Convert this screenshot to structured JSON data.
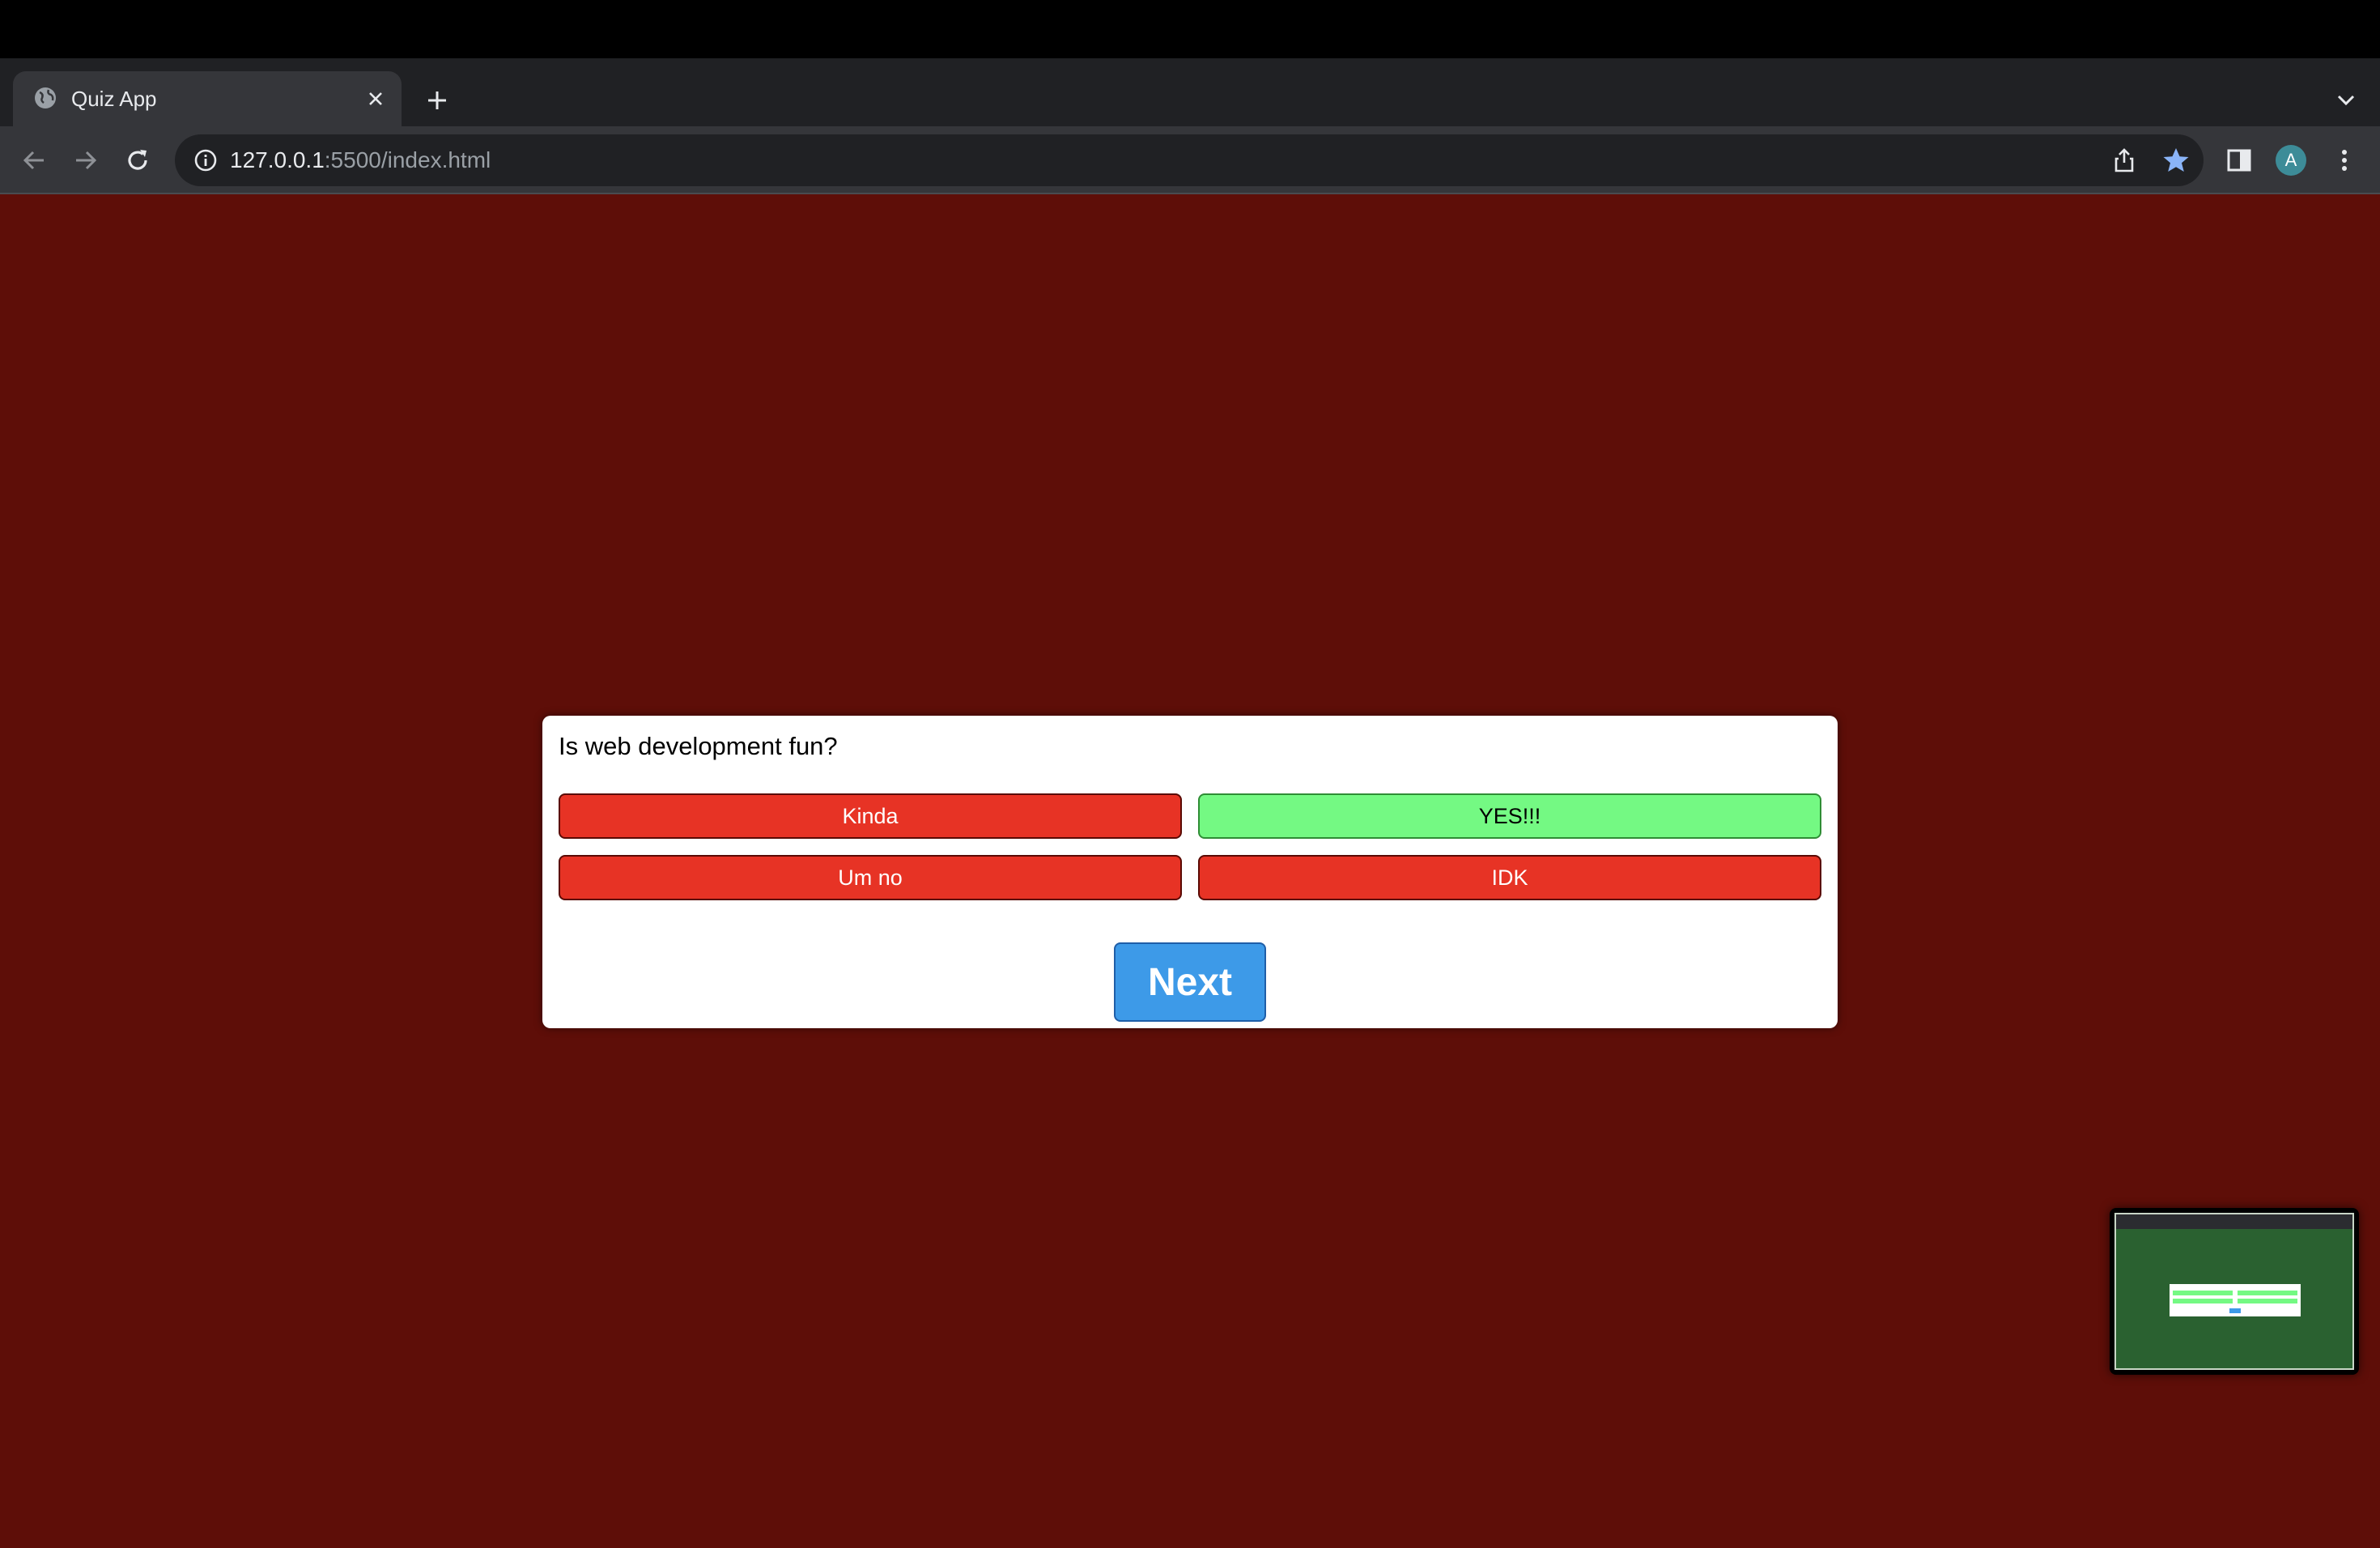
{
  "browser": {
    "tab": {
      "title": "Quiz App",
      "favicon": "globe-icon"
    },
    "address_bar": {
      "url_host": "127.0.0.1",
      "url_rest": ":5500/index.html"
    },
    "profile_initial": "A",
    "colors": {
      "tabstrip": "#202124",
      "toolbar": "#35363a",
      "bookmark_star": "#8ab4f8",
      "avatar": "#3d8c98"
    }
  },
  "quiz": {
    "question": "Is web development fun?",
    "answers": [
      {
        "label": "Kinda",
        "state": "wrong"
      },
      {
        "label": "YES!!!",
        "state": "correct"
      },
      {
        "label": "Um no",
        "state": "wrong"
      },
      {
        "label": "IDK",
        "state": "wrong"
      }
    ],
    "next_label": "Next",
    "colors": {
      "background": "#5e0e08",
      "wrong": "#e73325",
      "correct": "#74f983",
      "next": "#3d9ae8"
    }
  },
  "preview": {
    "background": "#2a6130"
  }
}
